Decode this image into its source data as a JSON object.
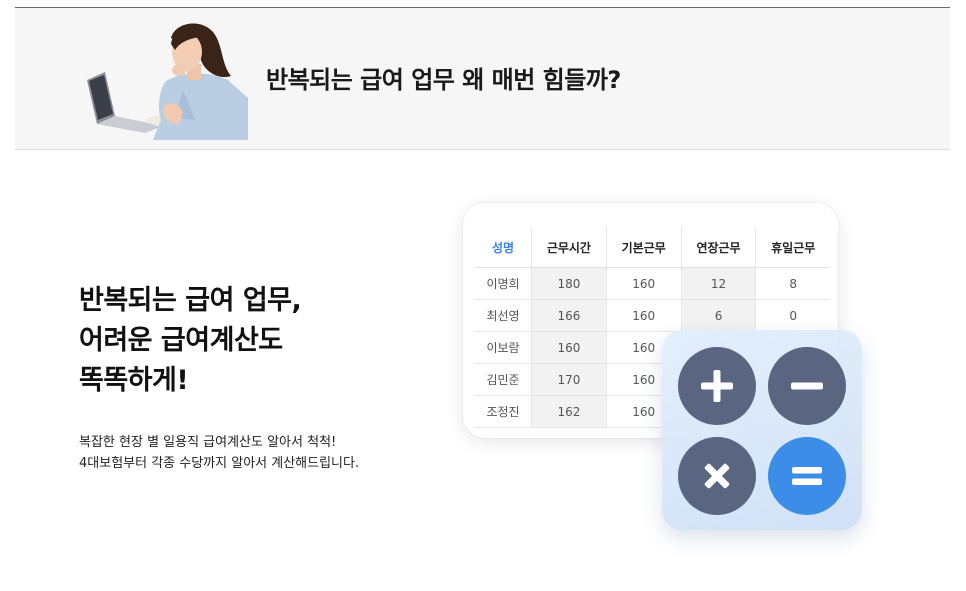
{
  "banner": {
    "title": "반복되는 급여 업무 왜 매번 힘들까?",
    "illustration_icon": "woman-with-laptop-illustration"
  },
  "hero": {
    "title_lines": [
      "반복되는 급여 업무,",
      "어려운 급여계산도",
      "똑똑하게!"
    ],
    "desc_lines": [
      "복잡한 현장 별 일용직 급여계산도 알아서 척척!",
      "4대보험부터 각종 수당까지 알아서 계산해드립니다."
    ]
  },
  "payroll_table": {
    "headers": [
      "성명",
      "근무시간",
      "기본근무",
      "연장근무",
      "휴일근무"
    ],
    "rows": [
      [
        "이명희",
        "180",
        "160",
        "12",
        "8"
      ],
      [
        "최선영",
        "166",
        "160",
        "6",
        "0"
      ],
      [
        "이보람",
        "160",
        "160",
        "",
        ""
      ],
      [
        "김민준",
        "170",
        "160",
        "",
        ""
      ],
      [
        "조정진",
        "162",
        "160",
        "",
        ""
      ]
    ]
  },
  "calculator": {
    "buttons": [
      {
        "icon": "plus-icon",
        "color": "#5a6582"
      },
      {
        "icon": "minus-icon",
        "color": "#5a6582"
      },
      {
        "icon": "multiply-icon",
        "color": "#5a6582"
      },
      {
        "icon": "equals-icon",
        "color": "#3b8de8"
      }
    ]
  },
  "colors": {
    "accent_blue": "#3b82e8",
    "button_dark": "#5a6582",
    "banner_bg": "#f6f6f6"
  }
}
